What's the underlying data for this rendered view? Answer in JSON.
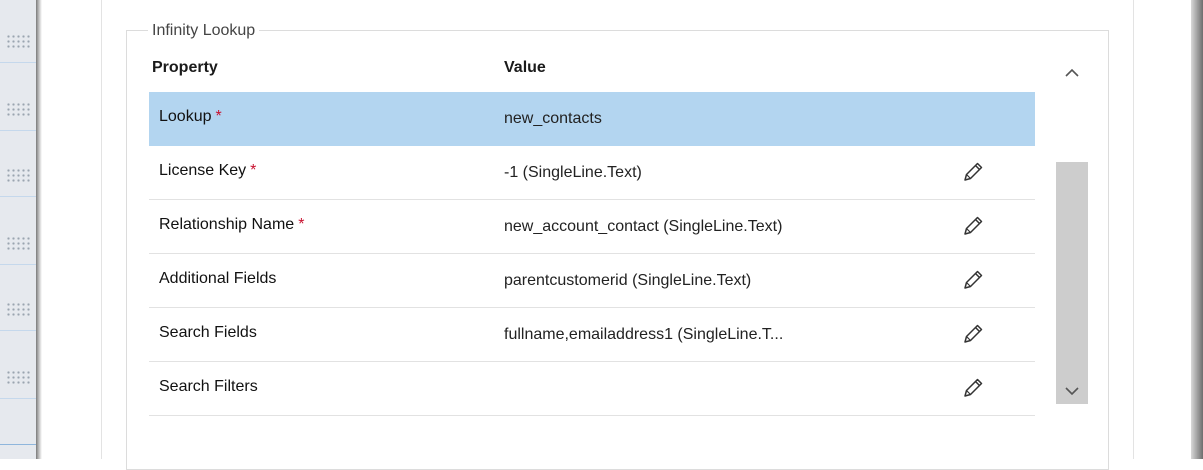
{
  "group_title": "Infinity Lookup",
  "headers": {
    "property": "Property",
    "value": "Value"
  },
  "required_marker": "*",
  "rows": [
    {
      "property": "Lookup",
      "required": true,
      "value": "new_contacts",
      "selected": true,
      "editable": false
    },
    {
      "property": "License Key",
      "required": true,
      "value": "-1 (SingleLine.Text)",
      "selected": false,
      "editable": true
    },
    {
      "property": "Relationship Name",
      "required": true,
      "value": "new_account_contact (SingleLine.Text)",
      "selected": false,
      "editable": true
    },
    {
      "property": "Additional Fields",
      "required": false,
      "value": "parentcustomerid (SingleLine.Text)",
      "selected": false,
      "editable": true
    },
    {
      "property": "Search Fields",
      "required": false,
      "value": "fullname,emailaddress1 (SingleLine.T...",
      "selected": false,
      "editable": true
    },
    {
      "property": "Search Filters",
      "required": false,
      "value": "",
      "selected": false,
      "editable": true
    }
  ],
  "icons": {
    "edit": "pencil-icon",
    "scroll_up": "chevron-up-icon",
    "scroll_down": "chevron-down-icon"
  },
  "colors": {
    "selected_row": "#b3d5f0",
    "required": "#c8102e",
    "scroll_thumb": "#cdcdcd"
  }
}
